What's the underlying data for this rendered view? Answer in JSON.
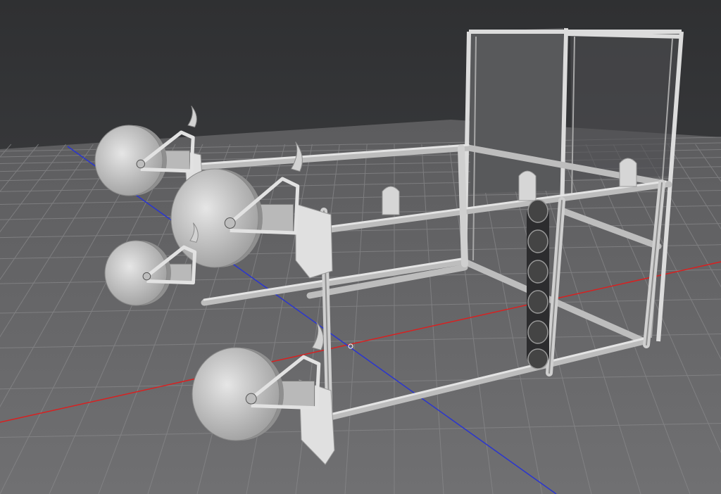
{
  "viewport": {
    "description_visible_text": "",
    "background_top": "#2e2f31",
    "background_bottom": "#4a4b4e",
    "floor_color": "#6a6a6c",
    "grid_color": "#8d8e90",
    "x_axis_color": "#d92020",
    "z_axis_color": "#2030c8",
    "frame_color": "#d8d8d8",
    "wheel_color": "#cfcfcf",
    "panel_color": "#5a5a5c"
  }
}
